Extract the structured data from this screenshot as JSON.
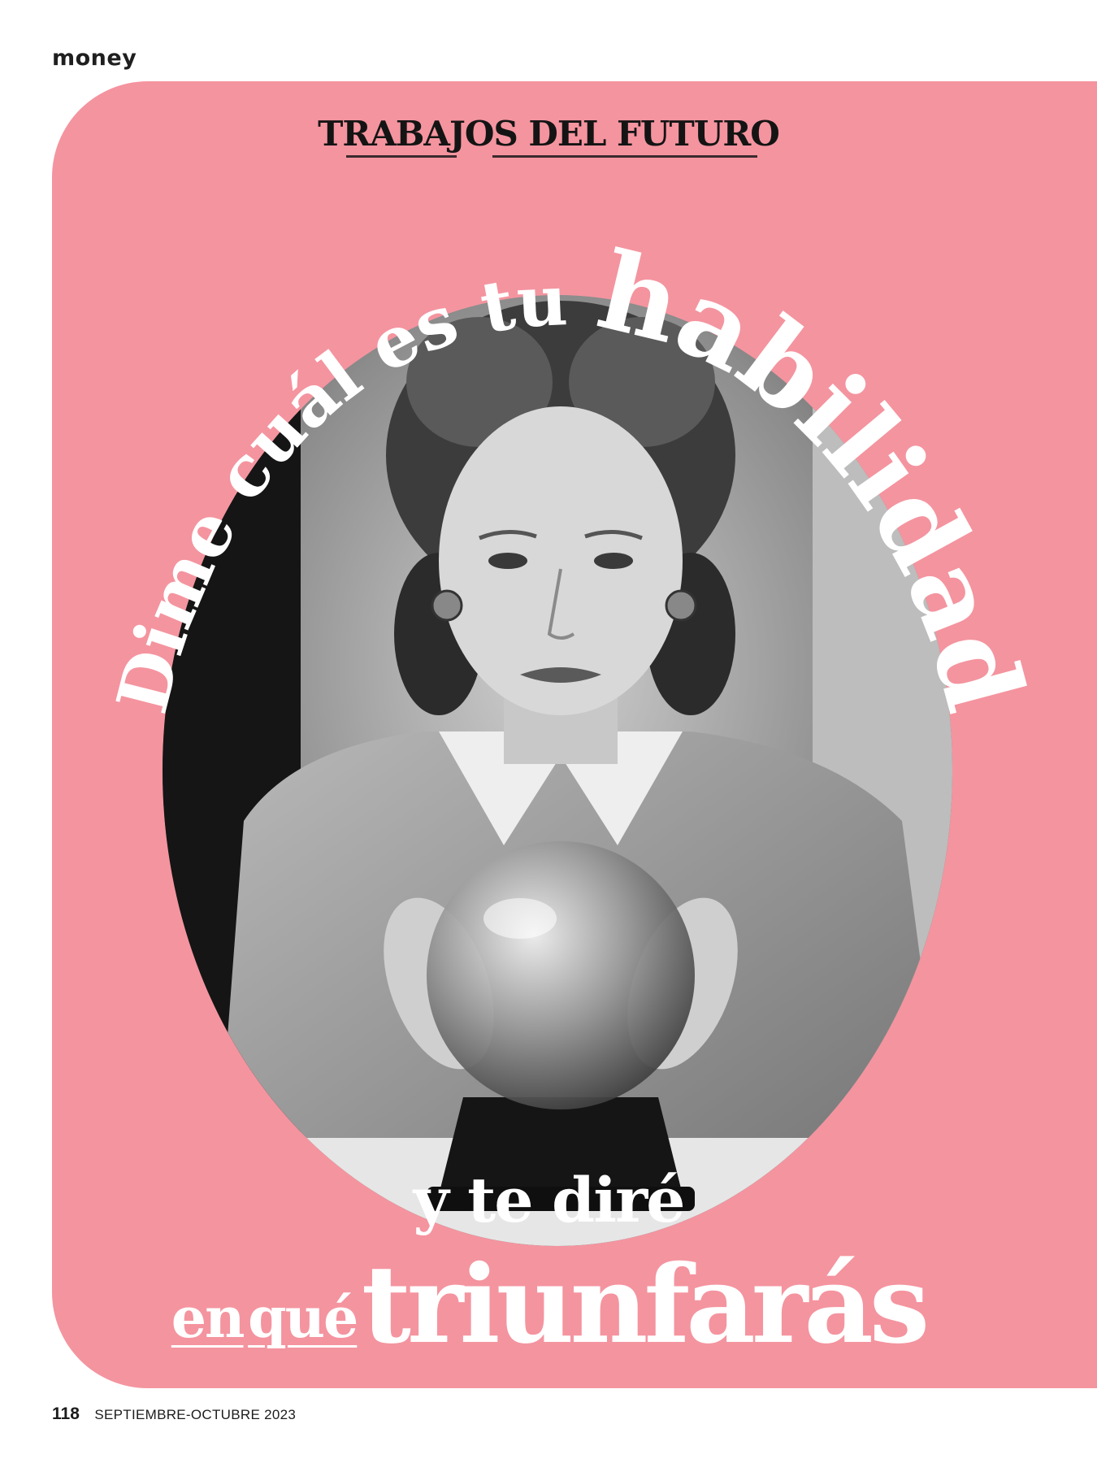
{
  "header": {
    "section": "money"
  },
  "headline": {
    "kicker": "TRABAJOS DEL FUTURO",
    "arc_small": "Dime cuál es tu",
    "arc_big": "habilidad",
    "line3": "y te diré",
    "line4_prefix_1": "en",
    "line4_prefix_2": "qué",
    "line4_big": "triunfarás"
  },
  "photo": {
    "description_icon": "vintage-portrait-crystal-ball"
  },
  "footer": {
    "page_number": "118",
    "issue": "SEPTIEMBRE-OCTUBRE 2023"
  },
  "colors": {
    "panel": "#f4949f",
    "ink": "#141414",
    "headline": "#ffffff"
  }
}
